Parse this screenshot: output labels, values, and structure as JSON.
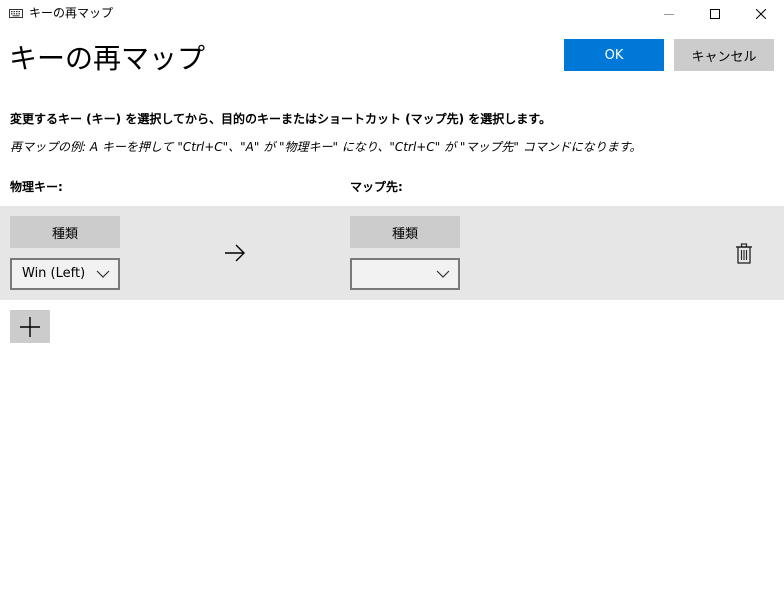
{
  "window": {
    "title": "キーの再マップ",
    "icon": "keyboard-icon",
    "controls": [
      "minimize-icon",
      "maximize-icon",
      "close-icon"
    ]
  },
  "header": {
    "title": "キーの再マップ",
    "ok_label": "OK",
    "cancel_label": "キャンセル"
  },
  "instructions": {
    "main": "変更するキー (キー) を選択してから、目的のキーまたはショートカット (マップ先) を選択します。",
    "example": "再マップの例: A キーを押して \"Ctrl+C\"、\"A\" が \"物理キー\" になり、\"Ctrl+C\" が \"マップ先\" コマンドになります。"
  },
  "columns": {
    "physical_key": "物理キー:",
    "mapped_to": "マップ先:"
  },
  "rows": [
    {
      "physical": {
        "type_label": "種類",
        "selected": "Win (Left)"
      },
      "mapped": {
        "type_label": "種類",
        "selected": ""
      },
      "arrow_icon": "arrow-right-icon",
      "delete_icon": "trash-icon"
    }
  ],
  "add_icon": "plus-icon",
  "colors": {
    "accent": "#0078d7",
    "button_gray": "#cccccc",
    "row_background": "#e6e6e6",
    "combo_border": "#7a7a7a"
  }
}
